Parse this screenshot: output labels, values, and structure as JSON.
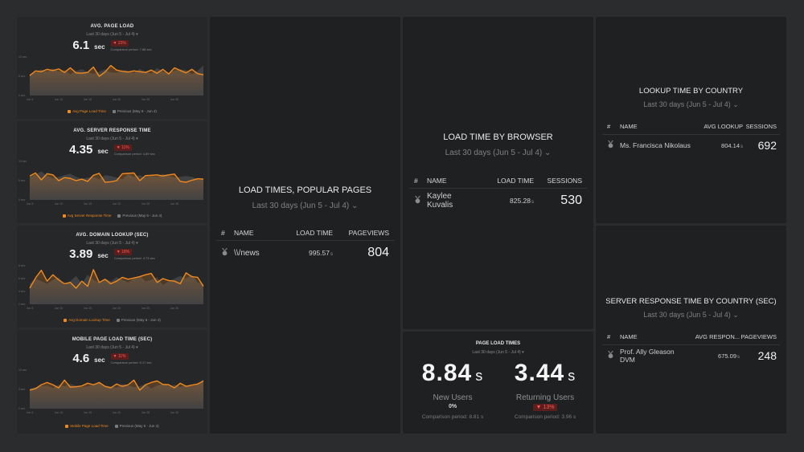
{
  "colors": {
    "accent": "#f0891e",
    "previous": "#4a4b4e",
    "negative": "#ff5a4f",
    "background": "#2b2c2e",
    "panel": "#1f2022"
  },
  "mini_panels": [
    {
      "id": "pageload",
      "title": "AVG. PAGE LOAD",
      "range": "Last 30 days (Jun 5 - Jul 4) ▾",
      "value": "6.1",
      "unit": "sec",
      "delta": "▼ 23%",
      "comparison": "Comparison period: 7.88 sec",
      "legend_current": "Avg Page Load Time",
      "legend_previous": "Previous (May 6 - Jun 4)"
    },
    {
      "id": "server",
      "title": "AVG. SERVER RESPONSE TIME",
      "range": "Last 30 days (Jun 5 - Jul 4) ▾",
      "value": "4.35",
      "unit": "sec",
      "delta": "▼ 11%",
      "comparison": "Comparison period: 4.89 sec",
      "legend_current": "Avg Server Response Time",
      "legend_previous": "Previous (May 6 - Jun 4)"
    },
    {
      "id": "domain",
      "title": "AVG. DOMAIN LOOKUP (SEC)",
      "range": "Last 30 days (Jun 5 - Jul 4) ▾",
      "value": "3.89",
      "unit": "sec",
      "delta": "▼ 18%",
      "comparison": "Comparison period: 4.73 sec",
      "legend_current": "Avg Domain Lookup Time",
      "legend_previous": "Previous (May 6 - Jun 4)"
    },
    {
      "id": "mobile",
      "title": "MOBILE PAGE LOAD TIME (SEC)",
      "range": "Last 30 days (Jun 5 - Jul 4) ▾",
      "value": "4.6",
      "unit": "sec",
      "delta": "▼ 11%",
      "comparison": "Comparison period: 5.17 sec",
      "legend_current": "Mobile Page Load Time",
      "legend_previous": "Previous (May 6 - Jun 4)"
    }
  ],
  "chart_data": [
    {
      "type": "area",
      "title": "AVG. PAGE LOAD",
      "x_ticks": [
        "Jun 5",
        "Jun 10",
        "Jun 15",
        "Jun 20",
        "Jun 25",
        "Jun 30"
      ],
      "y_ticks": [
        "0 sec",
        "5 sec",
        "10 sec"
      ],
      "ylim": [
        0,
        10
      ],
      "series": [
        {
          "name": "Avg Page Load Time",
          "values": [
            5.2,
            6.4,
            6.2,
            6.8,
            6.5,
            6.9,
            6.0,
            7.2,
            5.9,
            5.8,
            6.0,
            7.4,
            5.0,
            6.1,
            7.8,
            6.6,
            6.3,
            6.1,
            6.4,
            6.2,
            6.0,
            6.6,
            5.8,
            6.8,
            5.6,
            7.2,
            6.5,
            5.9,
            6.8,
            5.7,
            5.4
          ]
        },
        {
          "name": "Previous (May 6 - Jun 4)",
          "values": [
            5.6,
            6.0,
            6.8,
            6.2,
            7.0,
            6.2,
            6.6,
            5.5,
            6.4,
            6.8,
            6.1,
            5.6,
            6.2,
            6.8,
            6.0,
            5.9,
            6.6,
            6.4,
            5.8,
            6.9,
            6.2,
            5.7,
            7.2,
            6.2,
            6.0,
            6.4,
            6.8,
            6.6,
            5.5,
            6.4,
            7.8
          ]
        }
      ]
    },
    {
      "type": "area",
      "title": "AVG. SERVER RESPONSE TIME",
      "x_ticks": [
        "Jun 5",
        "Jun 10",
        "Jun 15",
        "Jun 20",
        "Jun 25",
        "Jun 30"
      ],
      "y_ticks": [
        "0 sec",
        "5 sec",
        "10 sec"
      ],
      "ylim": [
        0,
        10
      ],
      "series": [
        {
          "name": "Avg Server Response Time",
          "values": [
            6.2,
            7.0,
            5.2,
            6.8,
            6.5,
            5.0,
            5.8,
            5.6,
            5.0,
            5.4,
            4.8,
            6.4,
            6.9,
            4.6,
            4.7,
            5.0,
            6.8,
            6.9,
            7.0,
            5.0,
            6.3,
            6.4,
            6.5,
            6.2,
            6.5,
            6.7,
            4.8,
            4.6,
            5.1,
            5.5,
            5.4
          ]
        },
        {
          "name": "Previous (May 6 - Jun 4)",
          "values": [
            5.8,
            6.6,
            7.4,
            6.2,
            5.6,
            6.0,
            6.4,
            6.8,
            6.0,
            5.4,
            5.8,
            6.0,
            5.4,
            6.4,
            6.2,
            5.8,
            5.4,
            6.6,
            6.0,
            6.4,
            5.8,
            6.2,
            6.0,
            6.8,
            6.2,
            5.8,
            6.0,
            6.2,
            6.0,
            5.4,
            5.6
          ]
        }
      ]
    },
    {
      "type": "area",
      "title": "AVG. DOMAIN LOOKUP (SEC)",
      "x_ticks": [
        "Jun 5",
        "Jun 10",
        "Jun 15",
        "Jun 20",
        "Jun 25",
        "Jun 30"
      ],
      "y_ticks": [
        "2 sec",
        "4 sec",
        "6 sec",
        "8 sec"
      ],
      "ylim": [
        2,
        8
      ],
      "series": [
        {
          "name": "Avg Domain Lookup Time",
          "values": [
            4.5,
            6.1,
            7.3,
            5.6,
            6.6,
            5.8,
            5.2,
            5.4,
            4.5,
            5.6,
            4.8,
            7.4,
            5.4,
            5.9,
            5.2,
            5.6,
            6.2,
            5.9,
            6.1,
            6.3,
            6.6,
            6.8,
            5.4,
            6.0,
            5.7,
            5.6,
            5.2,
            6.9,
            6.3,
            6.2,
            4.8
          ]
        },
        {
          "name": "Previous (May 6 - Jun 4)",
          "values": [
            5.2,
            6.0,
            5.6,
            5.2,
            5.8,
            6.2,
            5.0,
            5.6,
            6.4,
            5.2,
            6.6,
            5.8,
            5.4,
            6.0,
            5.6,
            6.2,
            5.8,
            5.4,
            6.0,
            6.4,
            5.6,
            5.8,
            6.2,
            5.0,
            5.6,
            6.0,
            6.4,
            6.0,
            6.6,
            5.4,
            5.2
          ]
        }
      ]
    },
    {
      "type": "area",
      "title": "MOBILE PAGE LOAD TIME (SEC)",
      "x_ticks": [
        "Jun 5",
        "Jun 10",
        "Jun 15",
        "Jun 20",
        "Jun 25",
        "Jun 30"
      ],
      "y_ticks": [
        "0 sec",
        "5 sec",
        "10 sec"
      ],
      "ylim": [
        0,
        10
      ],
      "series": [
        {
          "name": "Mobile Page Load Time",
          "values": [
            4.8,
            5.2,
            6.2,
            6.8,
            6.2,
            5.4,
            7.4,
            5.6,
            5.7,
            5.9,
            6.6,
            6.2,
            6.8,
            5.8,
            5.4,
            6.4,
            5.8,
            6.2,
            7.4,
            4.8,
            6.2,
            6.8,
            7.2,
            6.3,
            6.2,
            5.4,
            6.6,
            5.8,
            6.1,
            6.4,
            7.2
          ]
        },
        {
          "name": "Previous (May 6 - Jun 4)",
          "values": [
            5.2,
            5.6,
            5.8,
            6.0,
            5.4,
            6.2,
            5.8,
            6.4,
            6.0,
            5.6,
            5.8,
            6.2,
            6.6,
            6.0,
            5.8,
            5.4,
            6.4,
            6.0,
            5.6,
            5.8,
            6.4,
            5.2,
            6.0,
            6.4,
            5.8,
            6.2,
            5.6,
            6.0,
            5.8,
            6.2,
            7.6
          ]
        }
      ]
    }
  ],
  "popular_pages": {
    "title": "LOAD TIMES, POPULAR PAGES",
    "range": "Last 30 days (Jun 5 - Jul 4) ⌄",
    "columns": [
      "#",
      "NAME",
      "LOAD TIME",
      "PAGEVIEWS"
    ],
    "rows": [
      {
        "name": "\\\\/news",
        "metric": "995.57",
        "metric_unit": "s",
        "count": "804"
      }
    ]
  },
  "browser": {
    "title": "LOAD TIME BY BROWSER",
    "range": "Last 30 days (Jun 5 - Jul 4) ⌄",
    "columns": [
      "#",
      "NAME",
      "LOAD TIME",
      "SESSIONS"
    ],
    "rows": [
      {
        "name": "Kaylee Kuvalis",
        "metric": "825.28",
        "metric_unit": "s",
        "count": "530"
      }
    ]
  },
  "page_load_times": {
    "title": "PAGE LOAD TIMES",
    "range": "Last 30 days (Jun 5 - Jul 4) ▾",
    "new_users": {
      "value": "8.84",
      "unit": "s",
      "label": "New Users",
      "delta": "0%",
      "comparison": "Comparison period: 8.81 s"
    },
    "returning_users": {
      "value": "3.44",
      "unit": "s",
      "label": "Returning Users",
      "delta": "▼ 13%",
      "comparison": "Comparison period: 3.96 s"
    }
  },
  "lookup_country": {
    "title": "LOOKUP TIME BY COUNTRY",
    "range": "Last 30 days (Jun 5 - Jul 4) ⌄",
    "columns": [
      "#",
      "NAME",
      "AVG LOOKUP",
      "SESSIONS"
    ],
    "rows": [
      {
        "name": "Ms. Francisca Nikolaus",
        "metric": "804.14",
        "metric_unit": "s",
        "count": "692"
      }
    ]
  },
  "server_country": {
    "title": "SERVER RESPONSE TIME BY COUNTRY (SEC)",
    "range": "Last 30 days (Jun 5 - Jul 4) ⌄",
    "columns": [
      "#",
      "NAME",
      "AVG RESPON...",
      "PAGEVIEWS"
    ],
    "rows": [
      {
        "name": "Prof. Ally Gleason DVM",
        "metric": "675.09",
        "metric_unit": "s",
        "count": "248"
      }
    ]
  }
}
